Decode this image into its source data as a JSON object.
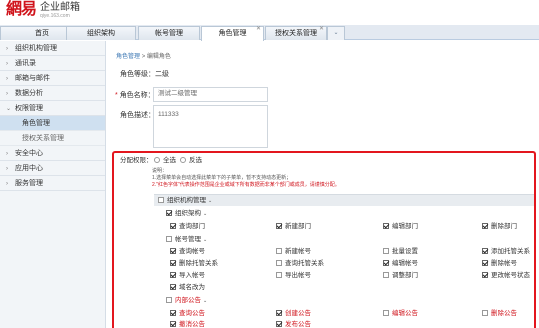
{
  "logo": {
    "mark": "網易",
    "title": "企业邮箱",
    "sub": "qiye.163.com"
  },
  "tabs": [
    {
      "label": "首页"
    },
    {
      "label": "组织架构"
    },
    {
      "label": "帐号管理"
    },
    {
      "label": "角色管理",
      "active": true
    },
    {
      "label": "授权关系管理"
    }
  ],
  "tab_more_icon": "chevron-down-icon",
  "sidebar": {
    "items": [
      {
        "label": "组织机构管理",
        "icon": "chevron-right-icon"
      },
      {
        "label": "通讯录",
        "icon": "chevron-right-icon"
      },
      {
        "label": "邮箱与邮件",
        "icon": "chevron-right-icon"
      },
      {
        "label": "数据分析",
        "icon": "chevron-right-icon"
      },
      {
        "label": "权限管理",
        "icon": "chevron-down-icon"
      }
    ],
    "subitems": [
      {
        "label": "角色管理",
        "active": true
      },
      {
        "label": "授权关系管理"
      }
    ],
    "items2": [
      {
        "label": "安全中心",
        "icon": "chevron-right-icon"
      },
      {
        "label": "应用中心",
        "icon": "chevron-right-icon"
      },
      {
        "label": "服务管理",
        "icon": "chevron-right-icon"
      }
    ]
  },
  "breadcrumb": {
    "link": "角色管理",
    "sep": ">",
    "current": "编辑角色"
  },
  "form": {
    "level_label": "角色等级：",
    "level_value": "二级",
    "name_required": "*",
    "name_label": "角色名称：",
    "name_value": "测试二级管理",
    "desc_label": "角色描述：",
    "desc_value": "111333"
  },
  "perm": {
    "label": "分配权限：",
    "opt_all": "全选",
    "opt_invert": "反选",
    "note_title": "说明：",
    "note1": "1.选择菜单会自动选择此菜单下的子菜单，暂不支持动态更新；",
    "note2": "2.\"红色字体\"代表操作范围是企业或域下所有数据而非某个部门或成员，请谨慎分配。",
    "group_title": "组织机构管理",
    "sections": [
      {
        "title": "组织架构",
        "red": false,
        "rows": [
          [
            "查询部门",
            "新建部门",
            "编辑部门",
            "删除部门"
          ]
        ]
      },
      {
        "title": "帐号管理",
        "red": false,
        "rows": [
          [
            "查询帐号",
            "新建帐号",
            "批量设置",
            "添加托管关系"
          ],
          [
            "删除托管关系",
            "查询托管关系",
            "编辑帐号",
            "删除帐号"
          ],
          [
            "导入帐号",
            "导出帐号",
            "调整部门",
            "更改帐号状态"
          ],
          [
            "域名改为"
          ]
        ]
      },
      {
        "title": "内部公告",
        "red": true,
        "rows": [
          [
            "查询公告",
            "创建公告",
            "编辑公告",
            "删除公告"
          ],
          [
            "撤消公告",
            "发布公告"
          ]
        ]
      }
    ]
  }
}
